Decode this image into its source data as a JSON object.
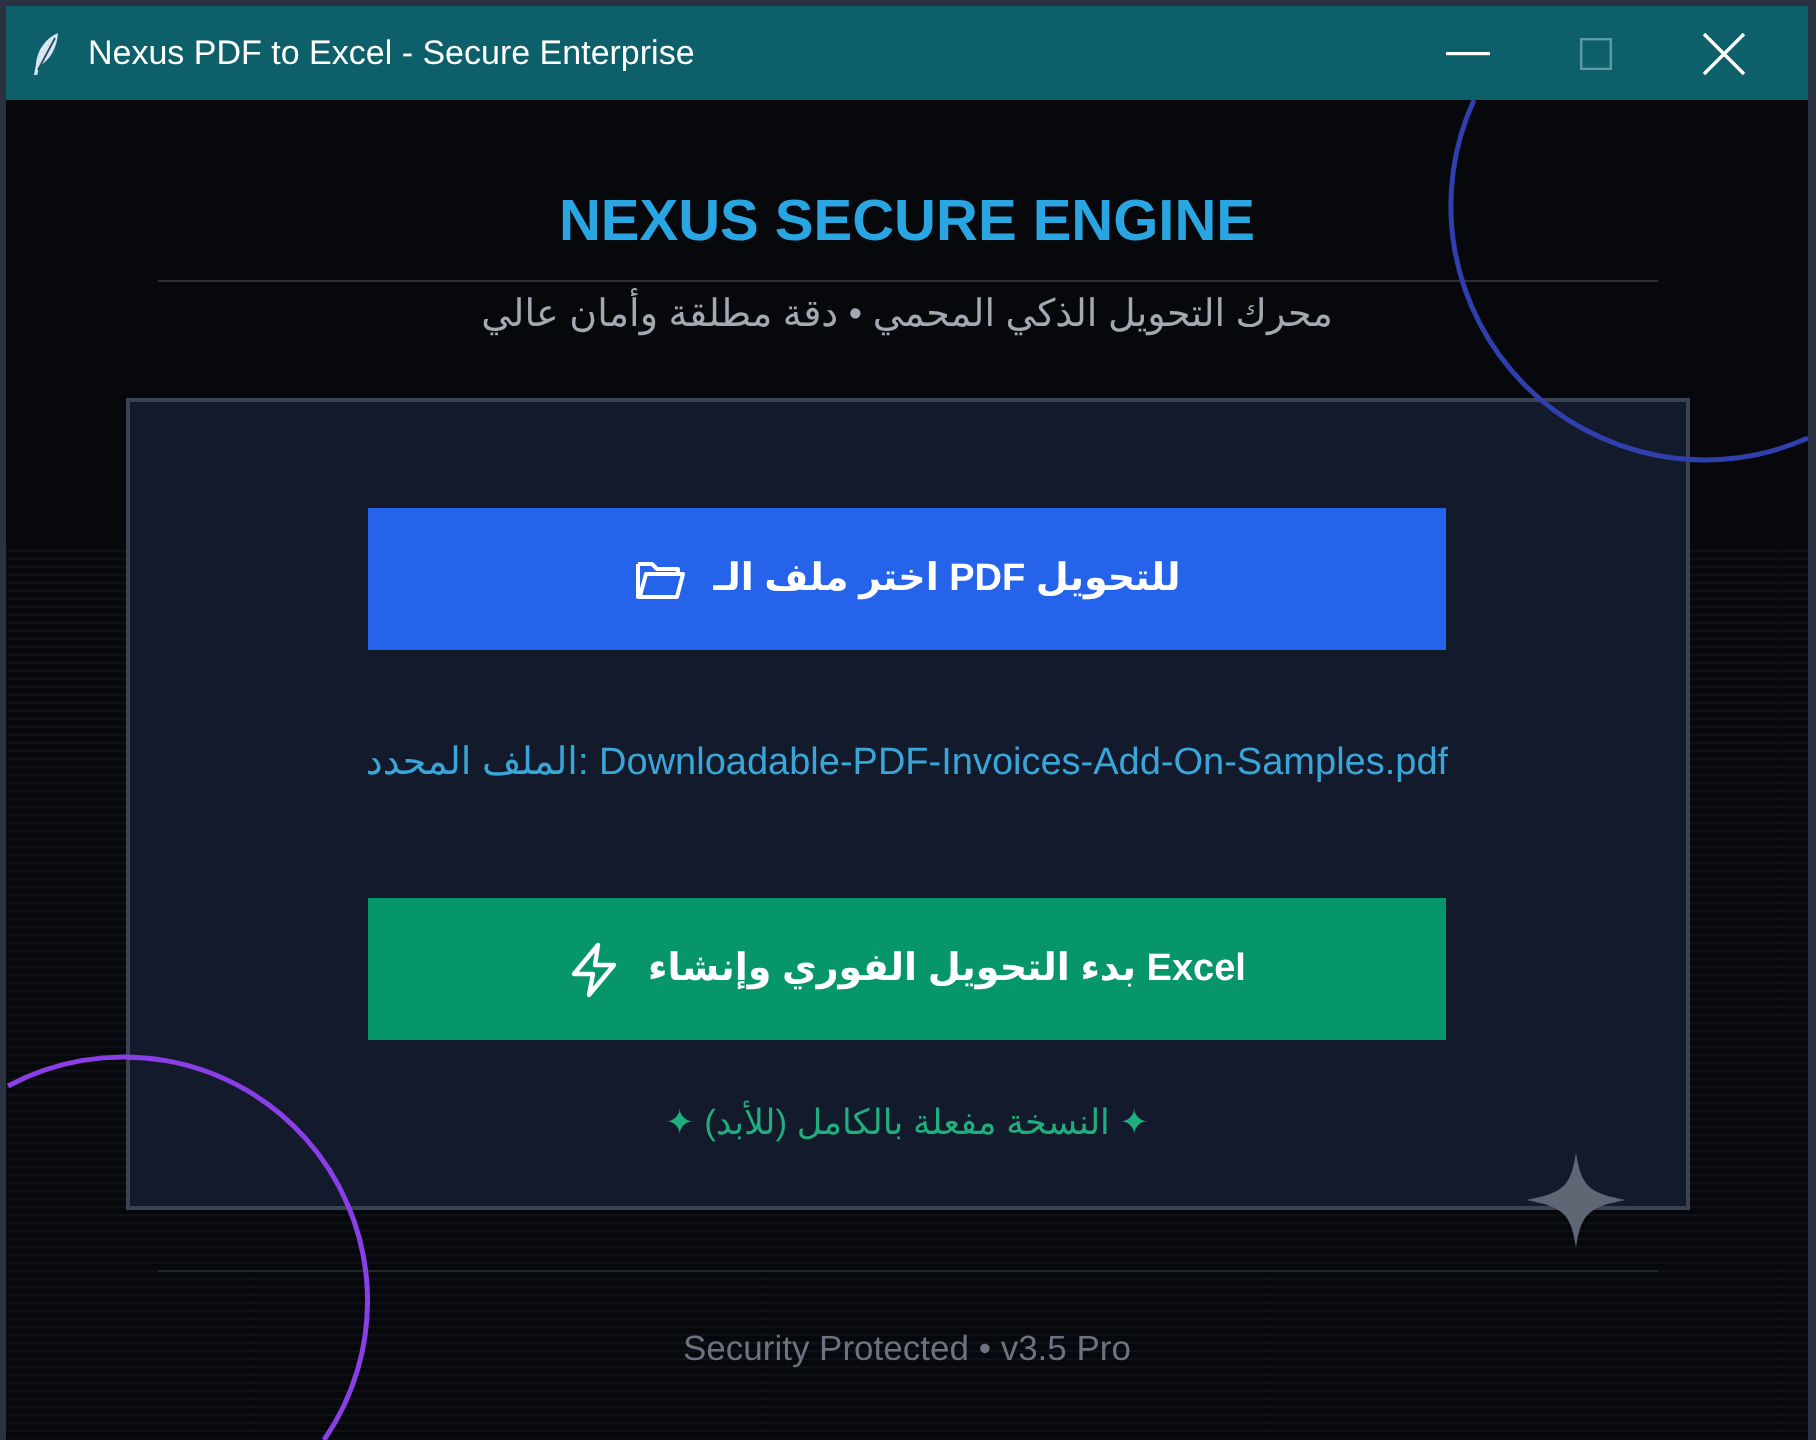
{
  "window": {
    "title": "Nexus PDF to Excel - Secure Enterprise",
    "controls": [
      {
        "kind": "minimize",
        "disabled": false
      },
      {
        "kind": "maximize",
        "disabled": true
      },
      {
        "kind": "close",
        "disabled": false
      }
    ]
  },
  "header": {
    "title": "NEXUS SECURE ENGINE",
    "subtitle": "محرك التحويل الذكي المحمي • دقة مطلقة وأمان عالي"
  },
  "card": {
    "select_button": {
      "label": "اختر ملف الـ PDF للتحويل"
    },
    "selected_file": "الملف المحدد: Downloadable-PDF-Invoices-Add-On-Samples.pdf",
    "convert_button": {
      "label": "بدء التحويل الفوري وإنشاء Excel"
    },
    "license_status": "✦ النسخة مفعلة بالكامل (للأبد) ✦"
  },
  "footer": {
    "text": "Security Protected • v3.5 Pro"
  }
}
